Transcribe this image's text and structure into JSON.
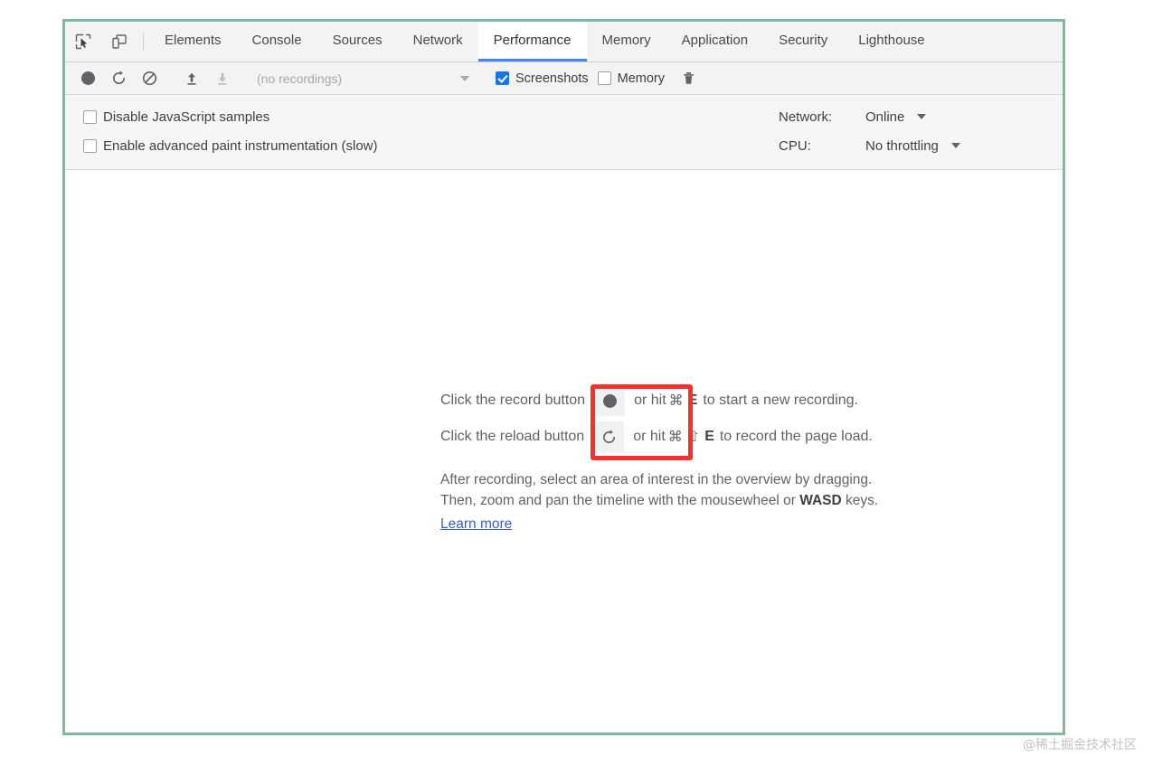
{
  "tabstrip": {
    "inspect_icon": "inspect-cursor-icon",
    "device_icon": "device-toolbar-icon",
    "tabs": [
      {
        "label": "Elements",
        "active": false
      },
      {
        "label": "Console",
        "active": false
      },
      {
        "label": "Sources",
        "active": false
      },
      {
        "label": "Network",
        "active": false
      },
      {
        "label": "Performance",
        "active": true
      },
      {
        "label": "Memory",
        "active": false
      },
      {
        "label": "Application",
        "active": false
      },
      {
        "label": "Security",
        "active": false
      },
      {
        "label": "Lighthouse",
        "active": false
      }
    ]
  },
  "controlbar": {
    "record_icon": "record-icon",
    "reload_icon": "reload-icon",
    "clear_icon": "clear-icon",
    "upload_icon": "upload-profile-icon",
    "download_icon": "download-profile-icon",
    "recordings_value": "(no recordings)",
    "screenshots_label": "Screenshots",
    "screenshots_checked": true,
    "memory_label": "Memory",
    "memory_checked": false,
    "trash_icon": "trash-icon"
  },
  "settings": {
    "disable_js_samples": {
      "label": "Disable JavaScript samples",
      "checked": false
    },
    "advanced_paint": {
      "label": "Enable advanced paint instrumentation (slow)",
      "checked": false
    },
    "network": {
      "key": "Network:",
      "value": "Online"
    },
    "cpu": {
      "key": "CPU:",
      "value": "No throttling"
    }
  },
  "instructions": {
    "record_line_pre": "Click the record button",
    "record_line_mid": "or hit",
    "record_cmd": "⌘",
    "record_key": "E",
    "record_line_post": "to start a new recording.",
    "reload_line_pre": "Click the reload button",
    "reload_line_mid": "or hit",
    "reload_cmd": "⌘",
    "reload_shift": "⇧",
    "reload_key": "E",
    "reload_line_post": "to record the page load.",
    "paragraph_line1": "After recording, select an area of interest in the overview by dragging.",
    "paragraph_line2_pre": "Then, zoom and pan the timeline with the mousewheel or",
    "paragraph_line2_bold": "WASD",
    "paragraph_line2_post": "keys.",
    "learn_more": "Learn more"
  },
  "annotation": {
    "color": "#f8302c"
  },
  "watermark": {
    "text": "@稀土掘金技术社区"
  },
  "colors": {
    "frame_border": "#80bb9e",
    "active_tab_underline": "#4285f4",
    "checkbox_accent": "#1a73e8",
    "link": "#3b5ec4"
  }
}
